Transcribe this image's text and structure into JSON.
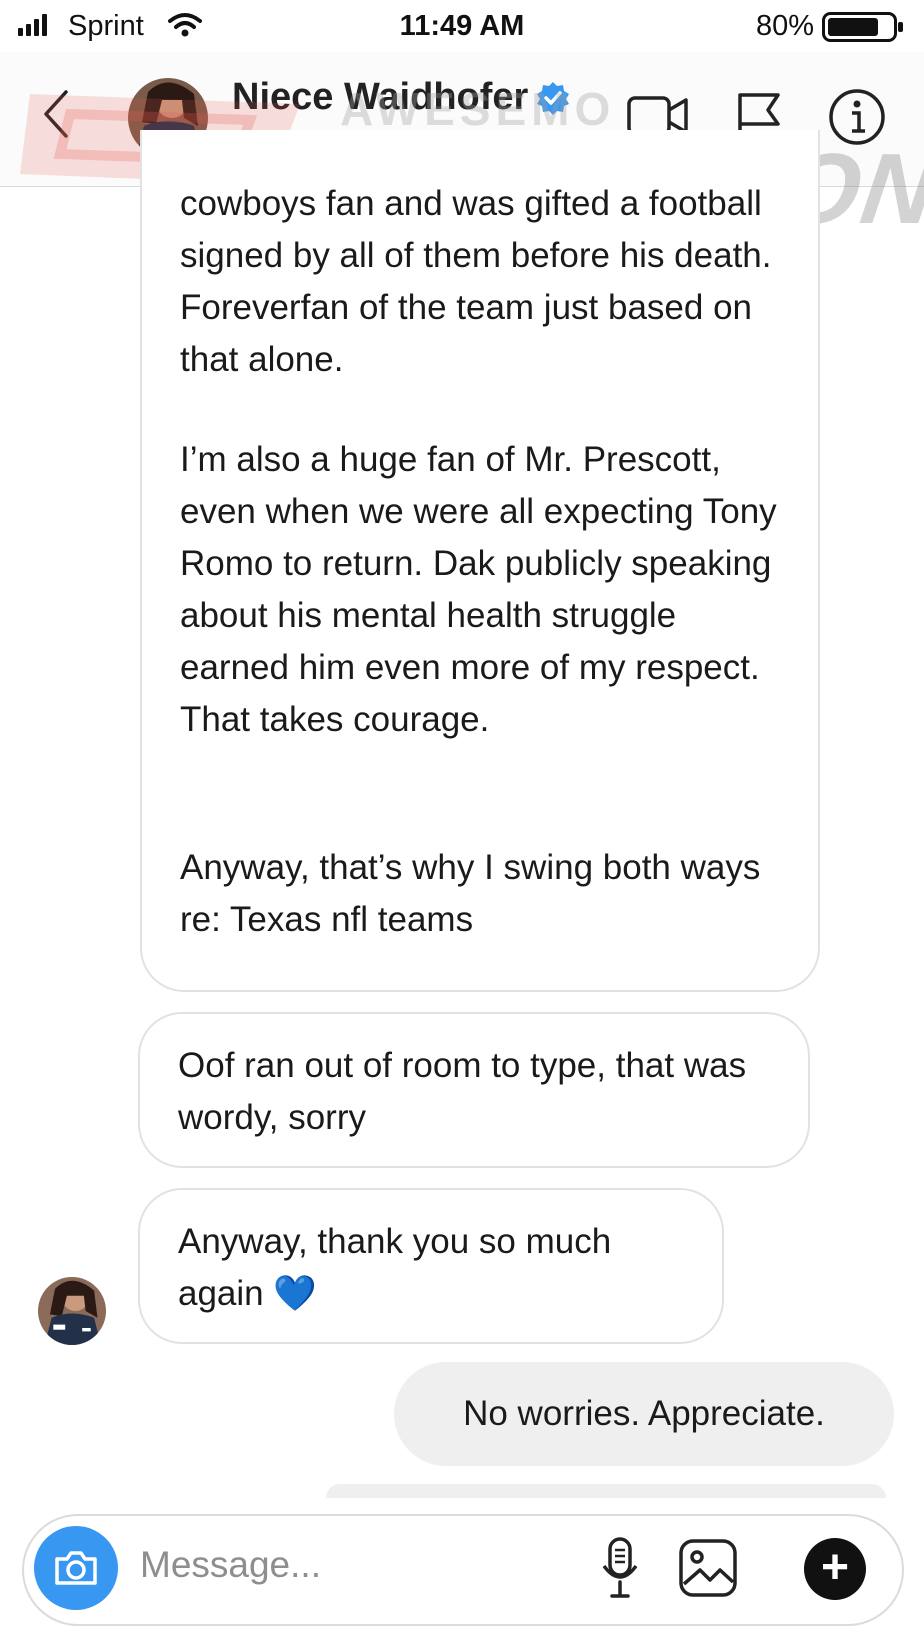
{
  "status_bar": {
    "carrier": "Sprint",
    "time": "11:49 AM",
    "battery": "80%",
    "icons": [
      "signal-icon",
      "wifi-icon",
      "battery-icon"
    ]
  },
  "header": {
    "name": "Niece Waidhofer",
    "username": "niecewaidhofer",
    "verified": true,
    "icons": [
      "back-chevron-icon",
      "video-call-icon",
      "flag-icon",
      "info-icon"
    ]
  },
  "watermark": {
    "top": "AWESEMO",
    "main": "SIDEACTION"
  },
  "messages": {
    "m1_lines_a": "cowboys fan and was gifted a football signed by all of them before his death. Foreverfan of the team just based on that alone.",
    "m1_lines_b": "I’m also a huge fan of Mr. Prescott, even when we were all expecting Tony Romo to return. Dak publicly speaking about his mental health struggle earned him even more of my respect. That takes courage.",
    "m1_lines_c": "Anyway, that’s why I swing both ways re: Texas nfl teams",
    "m2": "Oof ran out of room to type, that was wordy, sorry",
    "m3": "Anyway, thank you so much again 💙",
    "sent": "No worries. Appreciate."
  },
  "composer": {
    "placeholder": "Message...",
    "icons": [
      "camera-icon",
      "microphone-icon",
      "gallery-icon",
      "plus-icon"
    ]
  },
  "colors": {
    "accent_blue": "#3897f0",
    "bubble_border": "#e2e2e2",
    "sent_bubble": "#efefef",
    "muted": "#8e8e8e"
  }
}
